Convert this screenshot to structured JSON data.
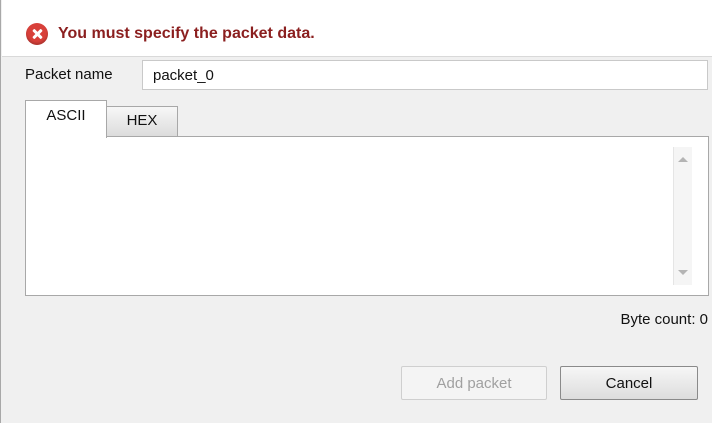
{
  "header": {
    "error_icon": "error-circle-x-icon",
    "error_message": "You must specify the packet data."
  },
  "packet_name": {
    "label": "Packet name",
    "value": "packet_0"
  },
  "tabs": [
    {
      "label": "ASCII",
      "selected": true
    },
    {
      "label": "HEX",
      "selected": false
    }
  ],
  "data_area": {
    "value": ""
  },
  "byte_count": "Byte count: 0",
  "buttons": {
    "add_label": "Add packet",
    "add_enabled": false,
    "cancel_label": "Cancel"
  },
  "colors": {
    "error_text": "#8b1f1f",
    "error_icon": "#d8403a"
  }
}
